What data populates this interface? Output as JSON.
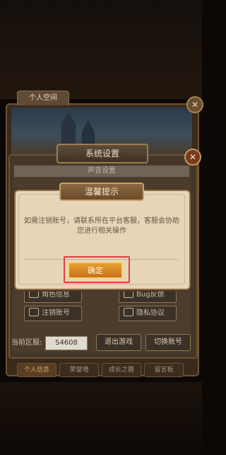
{
  "personal_space": {
    "tab_label": "个人空间"
  },
  "settings": {
    "title": "系统设置",
    "sound_section": "声音设置",
    "buttons": {
      "role_info": "角色信息",
      "bug_feedback": "Bug反馈",
      "cancel_account": "注销账号",
      "privacy": "隐私协议"
    },
    "region_label": "当前区服:",
    "region_value": "S4608",
    "exit_game": "退出游戏",
    "switch_account": "切换账号"
  },
  "bottom_tabs": [
    "个人信息",
    "荣誉墙",
    "成长之路",
    "留言板"
  ],
  "dialog": {
    "title": "温馨提示",
    "message": "如需注销账号，请联系所在平台客服，客服会协助您进行相关操作",
    "confirm_label": "确定"
  },
  "colors": {
    "highlight": "#e0413f",
    "confirm": "#d9861f"
  },
  "icons": [
    "close-icon",
    "user-icon",
    "bug-icon",
    "gamepad-icon",
    "document-icon"
  ]
}
